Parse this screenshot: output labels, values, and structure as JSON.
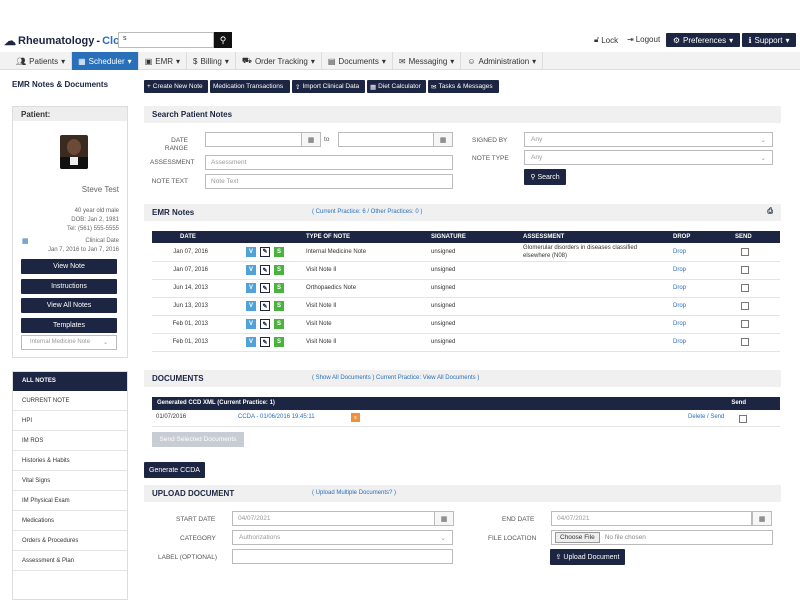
{
  "header": {
    "logo": "Rheumatology",
    "logo_accent": "Cloud",
    "search_value": "s",
    "lock": "Lock",
    "logout": "Logout",
    "preferences": "Preferences",
    "support": "Support"
  },
  "nav": [
    "Patients",
    "Scheduler",
    "EMR",
    "Billing",
    "Order Tracking",
    "Documents",
    "Messaging",
    "Administration"
  ],
  "sidebar": {
    "title": "EMR Notes & Documents",
    "patient_label": "Patient:",
    "patient_name": "Steve Test",
    "age": "40 year old male",
    "dob": "DOB: Jan 2, 1981",
    "tel": "Tel: (561) 555-5555",
    "clinical_label": "Clinical Date",
    "clinical_range": "Jan 7, 2016 to Jan 7, 2016",
    "buttons": [
      "View Note",
      "Instructions",
      "View All Notes",
      "Templates"
    ],
    "template_select": "Internal Medicine Note",
    "notes_header": "ALL NOTES",
    "notes": [
      "CURRENT NOTE",
      "HPI",
      "IM ROS",
      "Histories & Habits",
      "Vital Signs",
      "IM Physical Exam",
      "Medications",
      "Orders & Procedures",
      "Assessment & Plan"
    ]
  },
  "toolbar": [
    "Create New Note",
    "Medication Transactions",
    "Import Clinical Data",
    "Diet Calculator",
    "Tasks & Messages"
  ],
  "search": {
    "title": "Search Patient Notes",
    "date_range": "DATE RANGE",
    "to": "to",
    "assessment": "ASSESSMENT",
    "assessment_ph": "Assessment",
    "note_text": "NOTE TEXT",
    "note_text_ph": "Note Text",
    "signed_by": "SIGNED BY",
    "note_type": "NOTE TYPE",
    "any": "Any",
    "search_btn": "Search"
  },
  "emr": {
    "title": "EMR Notes",
    "practice_links": "( Current Practice: 6 / Other Practices: 0 )",
    "columns": [
      "DATE",
      "",
      "TYPE OF NOTE",
      "SIGNATURE",
      "ASSESSMENT",
      "DROP",
      "SEND"
    ],
    "rows": [
      {
        "date": "Jan 07, 2016",
        "type": "Internal Medicine Note",
        "sig": "unsigned",
        "assess": "Glomerular disorders in diseases classified elsewhere (N08)",
        "drop": "Drop"
      },
      {
        "date": "Jan 07, 2016",
        "type": "Visit Note II",
        "sig": "unsigned",
        "assess": "",
        "drop": "Drop"
      },
      {
        "date": "Jun 14, 2013",
        "type": "Orthopaedics Note",
        "sig": "unsigned",
        "assess": "",
        "drop": "Drop"
      },
      {
        "date": "Jun 13, 2013",
        "type": "Visit Note II",
        "sig": "unsigned",
        "assess": "",
        "drop": "Drop"
      },
      {
        "date": "Feb 01, 2013",
        "type": "Visit Note",
        "sig": "unsigned",
        "assess": "",
        "drop": "Drop"
      },
      {
        "date": "Feb 01, 2013",
        "type": "Visit Note II",
        "sig": "unsigned",
        "assess": "",
        "drop": "Drop"
      }
    ]
  },
  "docs": {
    "title": "DOCUMENTS",
    "links_a": "( Show All Documents )",
    "links_b": "Current Practice: View All Documents",
    "links_c": ")",
    "ccd_header": "Generated CCD XML (Current Practice: 1)",
    "send": "Send",
    "row_date": "01/07/2016",
    "row_link": "CCDA - 01/06/2016 19:45:11",
    "row_action": "Delete / Send",
    "send_selected": "Send Selected Documents",
    "generate": "Generate CCDA"
  },
  "upload": {
    "title": "UPLOAD DOCUMENT",
    "multi": "( Upload Multiple Documents? )",
    "start_label": "START DATE",
    "start_val": "04/07/2021",
    "end_label": "END DATE",
    "end_val": "04/07/2021",
    "category_label": "CATEGORY",
    "category_val": "Authorizations",
    "file_label": "FILE LOCATION",
    "choose": "Choose File",
    "no_file": "No file chosen",
    "label_label": "LABEL (OPTIONAL)",
    "upload_btn": "Upload Document"
  },
  "icons": {
    "print": "print-icon",
    "calendar": "calendar-icon",
    "xml": "xml-icon"
  },
  "colors": {
    "primary_dark": "#1c2541",
    "accent_blue": "#2a6fba",
    "v_badge": "#4fa3d9",
    "s_badge": "#4ab340"
  }
}
